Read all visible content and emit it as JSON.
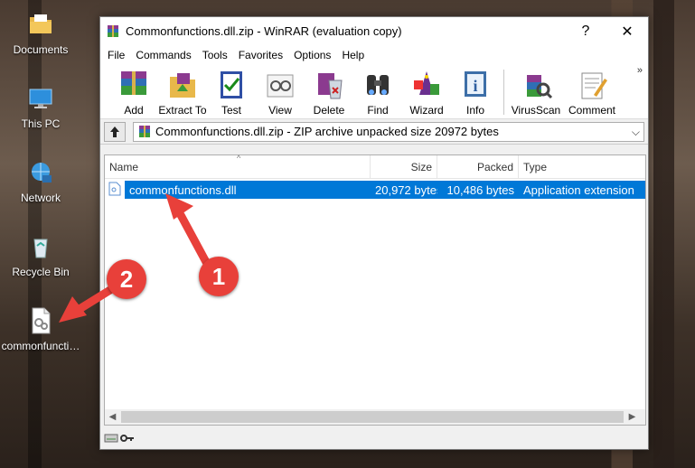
{
  "desktop": {
    "icons": [
      {
        "label": "Documents",
        "icon": "documents-folder-icon"
      },
      {
        "label": "This PC",
        "icon": "this-pc-icon"
      },
      {
        "label": "Network",
        "icon": "network-icon"
      },
      {
        "label": "Recycle Bin",
        "icon": "recycle-bin-icon"
      },
      {
        "label": "commonfuncti…",
        "icon": "dll-file-icon"
      }
    ]
  },
  "window": {
    "title": "Commonfunctions.dll.zip - WinRAR (evaluation copy)",
    "help_button": "?",
    "close_button": "✕"
  },
  "menu": [
    "File",
    "Commands",
    "Tools",
    "Favorites",
    "Options",
    "Help"
  ],
  "toolbar": {
    "buttons": [
      {
        "label": "Add",
        "icon": "add-archive-icon"
      },
      {
        "label": "Extract To",
        "icon": "extract-to-icon"
      },
      {
        "label": "Test",
        "icon": "test-icon"
      },
      {
        "label": "View",
        "icon": "view-icon"
      },
      {
        "label": "Delete",
        "icon": "delete-icon"
      },
      {
        "label": "Find",
        "icon": "find-binoculars-icon"
      },
      {
        "label": "Wizard",
        "icon": "wizard-icon"
      },
      {
        "label": "Info",
        "icon": "info-icon"
      },
      {
        "label": "VirusScan",
        "icon": "virus-scan-icon"
      },
      {
        "label": "Comment",
        "icon": "comment-icon"
      }
    ],
    "overflow": "»"
  },
  "address": {
    "path": "Commonfunctions.dll.zip - ZIP archive unpacked size 20972 bytes"
  },
  "filelist": {
    "columns": [
      "Name",
      "Size",
      "Packed",
      "Type"
    ],
    "rows": [
      {
        "name": "commonfunctions.dll",
        "size": "20,972 bytes",
        "packed": "10,486 bytes",
        "type": "Application extension",
        "selected": true
      }
    ]
  },
  "annotations": {
    "marker1": "1",
    "marker2": "2"
  },
  "colors": {
    "selection": "#0078d7",
    "marker": "#e8403a"
  }
}
